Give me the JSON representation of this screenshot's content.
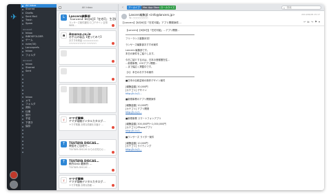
{
  "colors": {
    "accent": "#2e87d6",
    "sidebar": "#2c3138",
    "rail": "#1d2127",
    "btn_blue": "#2e87d6",
    "btn_green": "#2f9b47",
    "btn_gray": "#5a6470"
  },
  "sidebar": {
    "items": [
      {
        "label": "All Inbox",
        "selected": true
      },
      {
        "label": "Starred"
      },
      {
        "label": "Drafts"
      },
      {
        "label": "Sent Mail"
      },
      {
        "label": "Trash"
      },
      {
        "label": "Spam"
      }
    ],
    "account1": "account",
    "folders1": [
      "Inbox",
      "INBOXFOLDER",
      "ゲーム",
      "note(30)",
      "Lanceprefs",
      "Inbox",
      "フォルダ"
    ],
    "account2": "account",
    "folders2": [
      "Inbox",
      "Starred",
      "Sent",
      "",
      "",
      "",
      "",
      "",
      ""
    ],
    "folders3": [
      "Inbox",
      "メモ",
      "フォルダ",
      "資料",
      "仕事",
      "旅行",
      "予定",
      "下書き",
      "保存",
      "",
      "",
      "",
      "",
      "",
      "",
      ""
    ]
  },
  "list": {
    "title": "All Inbox",
    "cards": [
      {
        "icon": "L",
        "sender": "Lancers編集部",
        "subject": "【Lancers】【6月6日】「在宅可」 生活好き",
        "preview": "ランサーズ案件通知 ロゴデザイン 記事 WEB…",
        "time": "",
        "flag": true
      },
      {
        "icon": "a",
        "sender": "Amazon.co.jp",
        "subject": "お手元の製品【使ってみて】",
        "preview": "おすすめ商品 ○○○○○○○○ ○○○○○○○○○ ○○○○○",
        "time": "",
        "flag": true
      },
      {
        "icon": "",
        "sender": "",
        "subject": "",
        "preview": "",
        "time": "",
        "flag": true
      },
      {
        "icon": "",
        "sender": "",
        "subject": "",
        "preview": "",
        "time": "",
        "flag": true
      },
      {
        "icon": "",
        "sender": "",
        "subject": "",
        "preview": "",
        "time": "",
        "flag": false
      },
      {
        "icon": "Y",
        "sender": "ヤマダ電機",
        "subject": "ヤマダ電機デジタルカタログ…",
        "preview": "ヤマダ電機 お得な情報をお届け …",
        "time": "",
        "flag": true
      },
      {
        "icon": "T",
        "sender": "TSUTAYA DISCAS…",
        "subject": "映画をご自宅で…",
        "preview": "TSUTAYA DISCAS からのお知らせ…",
        "time": "",
        "flag": true
      },
      {
        "icon": "T",
        "sender": "TSUTAYA DISCAS…",
        "subject": "新作DVD 最新作 …",
        "preview": "TSUTAYA DISCAS …",
        "time": "",
        "flag": true
      },
      {
        "icon": "Y",
        "sender": "ヤマダ電機",
        "subject": "ヤマダ電機デジタルカタログ…",
        "preview": "ヤマダ電機 お得な情報 …",
        "time": "",
        "flag": true
      }
    ]
  },
  "toolbar": {
    "btn1": "アーカイブ",
    "btn2": "Mac App Store",
    "btn3": "ローカライズ",
    "search_placeholder": "検索"
  },
  "message": {
    "from": "Lancers編集部 <info@lancers.jp>",
    "to": "To: ○○○○○○○○",
    "date": "2014/06/06 15:17",
    "subject": "【Lancers】【6月6日】「在宅可能」アプリ開発案件…",
    "body": [
      "【Lancers】【6月6日】「在宅可能」…アプリ開発…",
      "――――――――――――",
      "フリーランス募集状況！",
      "",
      "ランサーズ編集部おすすめ案件",
      "",
      "Lancers 編集部です。",
      "本日の案件をご紹介します。",
      "",
      "今日ご紹介するのは、日本の首都圏在住…",
      "…新規事業、iOSアプリ開発…",
      "…まで幅広く掲載中です。",
      "",
      "【1】 本日のおすすめ案件",
      "――――――――――――",
      "■日本の伝統芸術の新作デザイン案件",
      "",
      "[報酬金額] 30,000円",
      "[カテゴリ] デザイン",
      "http://lc.lc/1...",
      "",
      "■新規事業のアプリ開発案件",
      "",
      "[報酬金額] 10,000円",
      "[カテゴリ] アプリ開発",
      "http://lc.lc/1...",
      "",
      "■新規事業 スマートフォンアプリ",
      "",
      "[報酬金額] 300,000円〜1,000,000円",
      "[カテゴリ] iPhoneアプリ",
      "http://lc.lc/1...",
      "",
      "■ランサーズ ライター案件",
      "",
      "[報酬金額] 10,000円",
      "[カテゴリ] ライティング",
      "http://lc.lc/1..."
    ]
  }
}
